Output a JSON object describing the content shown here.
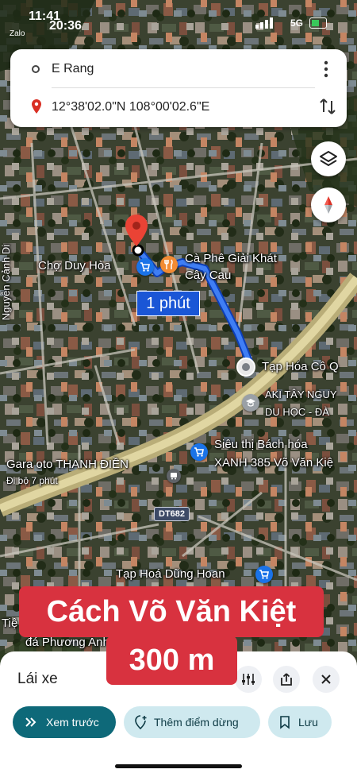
{
  "status_bar": {
    "time": "11:41",
    "app": "Zalo",
    "overlay_time": "20:36",
    "network": "5G"
  },
  "search": {
    "origin": "E Rang",
    "destination": "12°38'02.0\"N 108°00'02.6\"E"
  },
  "map_labels": {
    "market": "Chợ Duy Hòa",
    "cafe": "Cà Phê Giải Khát\nCây Cau",
    "duration": "1 phút",
    "street_left": "Nguyễn Cảnh Di",
    "grocery": "Tạp Hóa Cô Q",
    "school": "AKI TÂY NGUY\nDU HỌC - ĐÀ",
    "supermarket": "Siêu thị Bách hóa\nXANH 385 Võ Văn Kiệ",
    "garage": "Gara oto THANH ĐIỀN",
    "walk": "Đi bộ 7 phút",
    "road_badge": "DT682",
    "grocery2": "Tạp Hoá Dũng Hoan",
    "bottom_left_1": "Tiệ",
    "bottom_left_2": "đá Phương Anh"
  },
  "caption": {
    "line1": "Cách Võ Văn Kiệt",
    "line2": "300 m"
  },
  "sheet": {
    "mode": "Lái xe",
    "preview": "Xem trước",
    "add_stop": "Thêm điểm dừng",
    "save": "Lưu"
  },
  "colors": {
    "route": "#1a56d6",
    "caption": "#d8323f",
    "primary_pill": "#0e6979",
    "secondary_pill": "#cfe9ef"
  }
}
